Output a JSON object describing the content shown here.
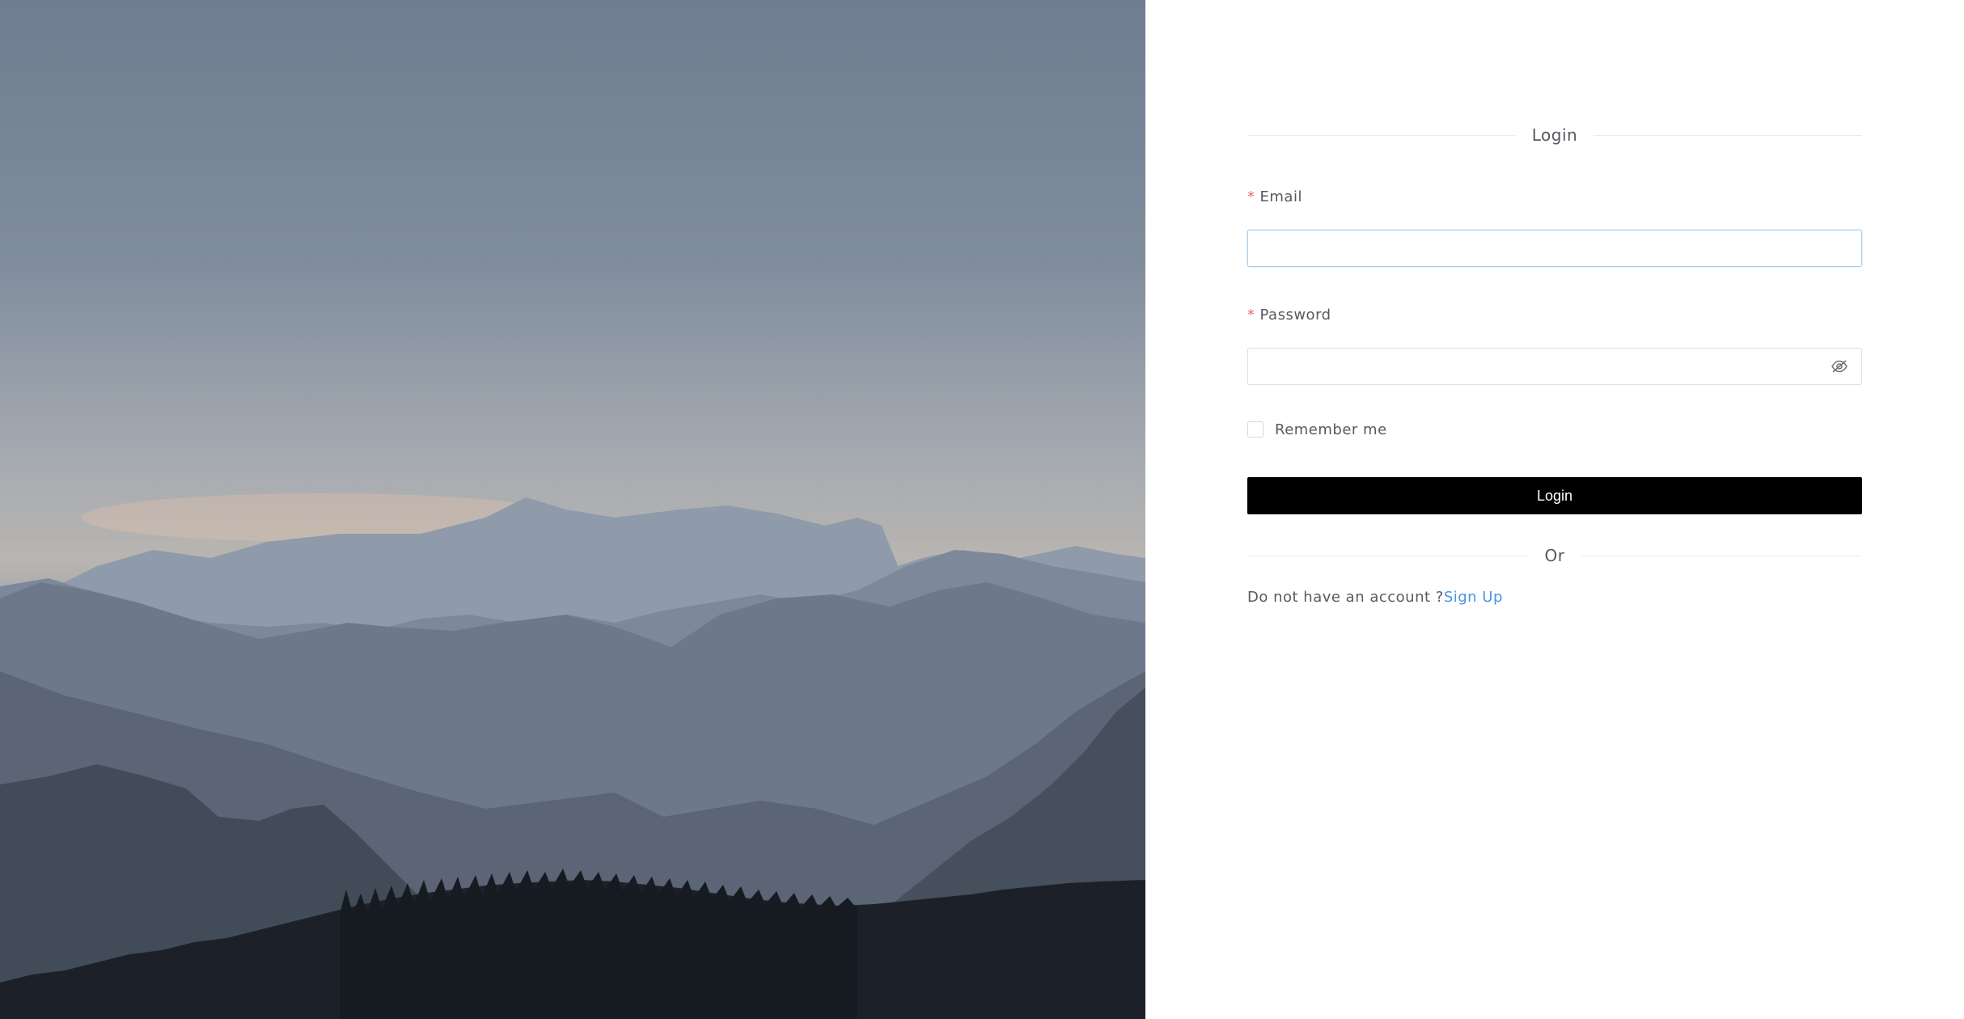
{
  "hero": {
    "image_name": "mountain-landscape-image"
  },
  "login_form": {
    "title": "Login",
    "email": {
      "label": "Email",
      "required_mark": "*",
      "value": "",
      "placeholder": ""
    },
    "password": {
      "label": "Password",
      "required_mark": "*",
      "value": "",
      "placeholder": "",
      "toggle_icon": "eye-slash-icon"
    },
    "remember": {
      "label": "Remember me",
      "checked": false
    },
    "submit_label": "Login",
    "or_divider": "Or",
    "signup_prompt": "Do not have an account ?",
    "signup_link": "Sign Up"
  },
  "colors": {
    "button_bg": "#000000",
    "link": "#4a93e8",
    "required": "#e06b6b",
    "focus_border": "#a9cdeb"
  }
}
